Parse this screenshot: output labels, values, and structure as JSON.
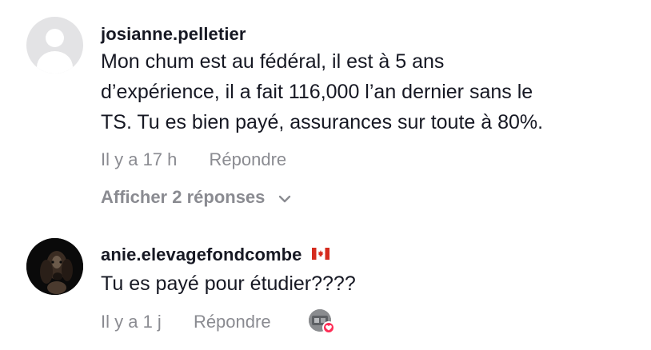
{
  "comments": [
    {
      "username": "josianne.pelletier",
      "text": "Mon chum est au fédéral, il est à 5 ans\nd’expérience, il a fait 116,000 l’an dernier sans le\nTS. Tu es bien payé, assurances sur toute à 80%.",
      "time": "Il y a 17 h",
      "reply_label": "Répondre",
      "show_replies_label": "Afficher 2 réponses",
      "avatar_icon": "default-user-avatar"
    },
    {
      "username": "anie.elevagefondcombe",
      "flag_icon": "canada-flag-icon",
      "text": "Tu es payé pour étudier????",
      "time": "Il y a 1 j",
      "reply_label": "Répondre",
      "avatar_icon": "dog-photo-avatar",
      "liked_by_creator_icon": "creator-liked-heart-icon"
    }
  ],
  "colors": {
    "text_primary": "#161823",
    "text_secondary": "#8a8b91",
    "heart": "#fe2c55",
    "flag_red": "#d52b1e",
    "avatar_placeholder": "#e3e3e5"
  }
}
